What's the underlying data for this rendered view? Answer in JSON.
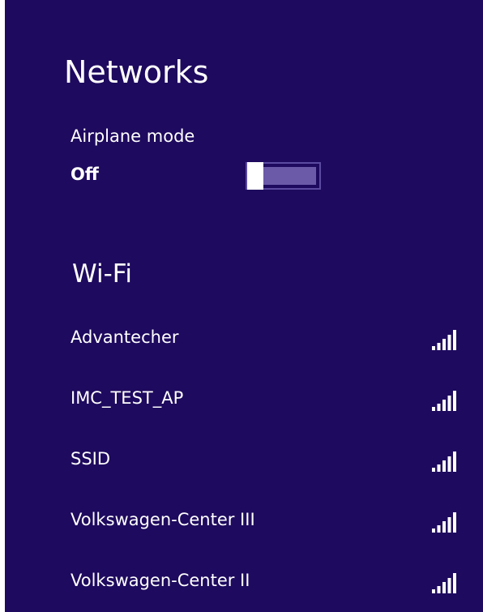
{
  "panel": {
    "title": "Networks"
  },
  "airplane_mode": {
    "label": "Airplane mode",
    "state": "Off"
  },
  "wifi": {
    "heading": "Wi-Fi",
    "networks": [
      {
        "name": "Advantecher",
        "signal_icon": "signal-strength-full-icon",
        "signal_bars": 5
      },
      {
        "name": "IMC_TEST_AP",
        "signal_icon": "signal-strength-full-icon",
        "signal_bars": 5
      },
      {
        "name": "SSID",
        "signal_icon": "signal-strength-full-icon",
        "signal_bars": 5
      },
      {
        "name": "Volkswagen-Center III",
        "signal_icon": "signal-strength-full-icon",
        "signal_bars": 5
      },
      {
        "name": "Volkswagen-Center II",
        "signal_icon": "signal-strength-full-icon",
        "signal_bars": 5
      }
    ]
  },
  "colors": {
    "panel_background": "#1e0a5e",
    "text": "#ffffff",
    "toggle_track": "#6a5aa8",
    "page_background": "#ffffff"
  }
}
